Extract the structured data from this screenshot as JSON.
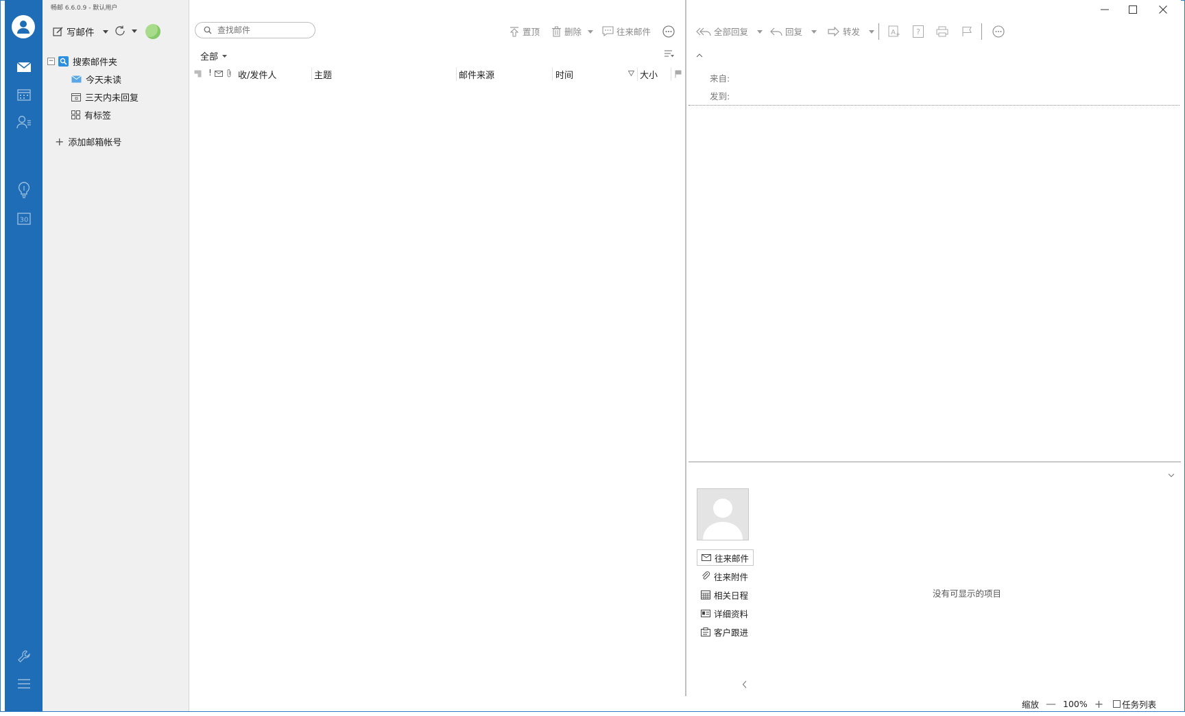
{
  "app": {
    "title": "畅邮 6.6.0.9 - 默认用户"
  },
  "rail": {
    "items": [
      {
        "icon": "mail-icon",
        "active": true
      },
      {
        "icon": "calendar-icon",
        "active": false
      },
      {
        "icon": "contacts-icon",
        "active": false
      },
      {
        "icon": "lightbulb-icon",
        "active": false
      },
      {
        "icon": "date-30-icon",
        "active": false
      },
      {
        "icon": "wrench-icon",
        "active": false
      },
      {
        "icon": "menu-icon",
        "active": false
      }
    ]
  },
  "folder_pane": {
    "compose_label": "写邮件",
    "tree": {
      "root_label": "搜索邮件夹",
      "children": [
        {
          "label": "今天未读",
          "icon": "envelope-icon"
        },
        {
          "label": "三天内未回复",
          "icon": "calendar-small-icon"
        },
        {
          "label": "有标签",
          "icon": "grid-icon"
        }
      ]
    },
    "add_account_label": "添加邮箱帐号"
  },
  "list_pane": {
    "search_placeholder": "查找邮件",
    "toolbar": {
      "pin_label": "置顶",
      "delete_label": "删除",
      "conversation_label": "往来邮件"
    },
    "filter_label": "全部",
    "columns": {
      "sender": "收/发件人",
      "subject": "主题",
      "source": "邮件来源",
      "time": "时间",
      "size": "大小"
    }
  },
  "read_pane": {
    "toolbar": {
      "reply_all_label": "全部回复",
      "reply_label": "回复",
      "forward_label": "转发"
    },
    "header": {
      "from_label": "来自:",
      "to_label": "发到:"
    },
    "side_links": [
      {
        "label": "往来邮件",
        "icon": "envelope-icon"
      },
      {
        "label": "往来附件",
        "icon": "paperclip-icon"
      },
      {
        "label": "相关日程",
        "icon": "calendar-small-icon"
      },
      {
        "label": "详细资料",
        "icon": "id-card-icon"
      },
      {
        "label": "客户跟进",
        "icon": "clipboard-icon"
      }
    ],
    "empty_text": "没有可显示的项目"
  },
  "status_bar": {
    "zoom_label": "缩放",
    "zoom_value": "100%",
    "task_list_label": "任务列表"
  },
  "colors": {
    "rail": "#1e6db6",
    "folder_bg": "#f0f0f0",
    "status_green": "#a8dc8a"
  }
}
